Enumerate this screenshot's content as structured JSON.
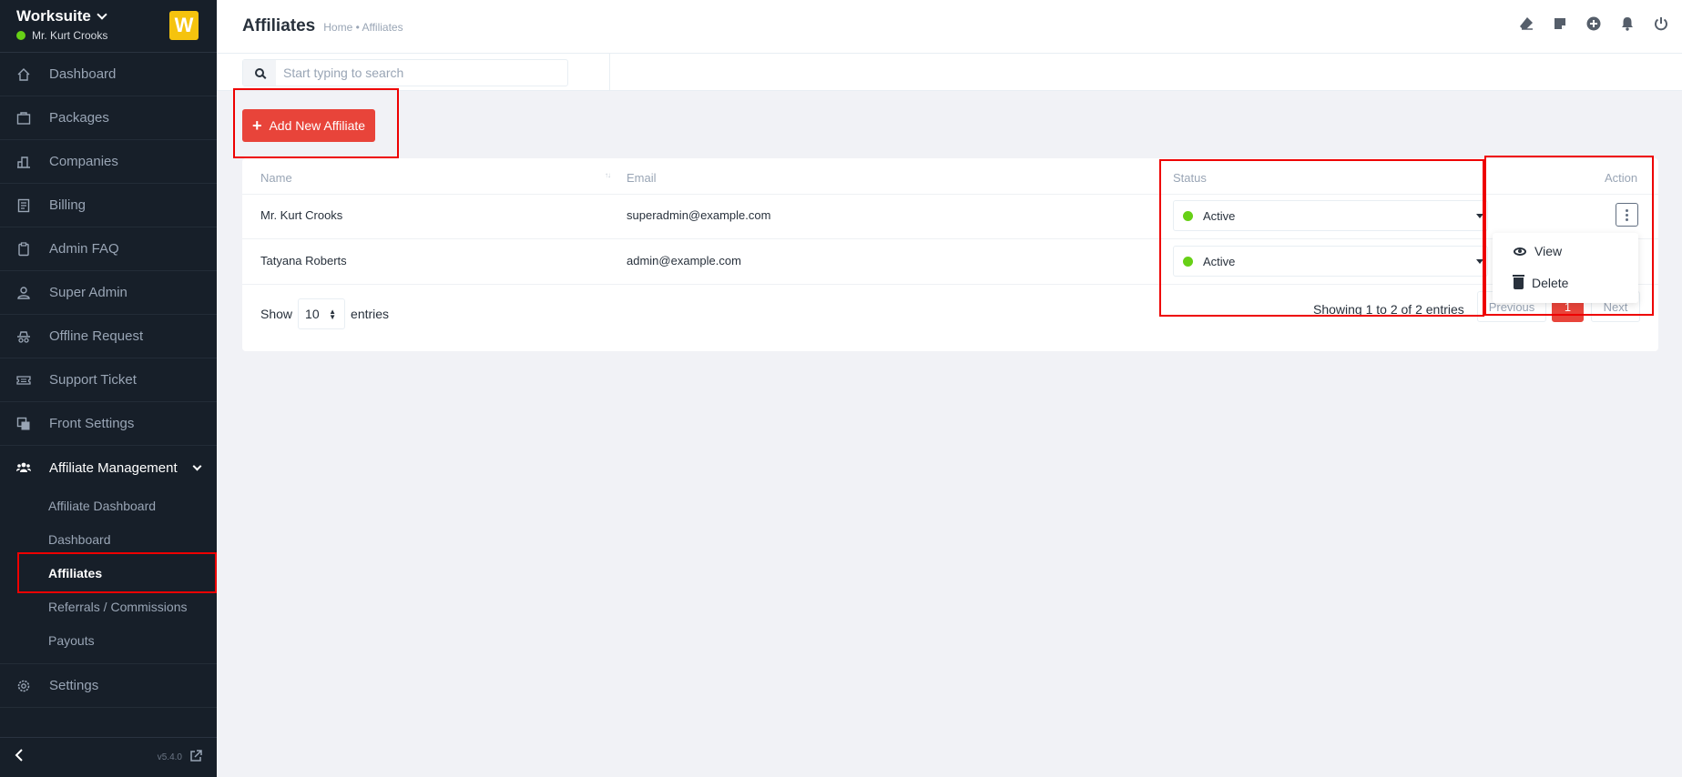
{
  "brand": {
    "name": "Worksuite",
    "user": "Mr. Kurt Crooks",
    "logo_letter": "W"
  },
  "sidebar": {
    "items": [
      {
        "label": "Dashboard",
        "icon": "home-icon"
      },
      {
        "label": "Packages",
        "icon": "package-icon"
      },
      {
        "label": "Companies",
        "icon": "building-icon"
      },
      {
        "label": "Billing",
        "icon": "receipt-icon"
      },
      {
        "label": "Admin FAQ",
        "icon": "clipboard-icon"
      },
      {
        "label": "Super Admin",
        "icon": "user-icon"
      },
      {
        "label": "Offline Request",
        "icon": "incognito-icon"
      },
      {
        "label": "Support Ticket",
        "icon": "ticket-icon"
      },
      {
        "label": "Front Settings",
        "icon": "layers-icon"
      }
    ],
    "group": {
      "label": "Affiliate Management",
      "icon": "users-icon",
      "sub_items": [
        "Affiliate Dashboard",
        "Dashboard",
        "Affiliates",
        "Referrals / Commissions",
        "Payouts"
      ],
      "active": "Affiliates"
    },
    "settings_label": "Settings",
    "version": "v5.4.0"
  },
  "header": {
    "title": "Affiliates",
    "breadcrumb": "Home • Affiliates",
    "icons": [
      "eraser-icon",
      "sticky-note-icon",
      "plus-circle-icon",
      "bell-icon",
      "power-icon"
    ]
  },
  "search": {
    "placeholder": "Start typing to search"
  },
  "toolbar": {
    "add_label": "Add New Affiliate"
  },
  "table": {
    "columns": {
      "name": "Name",
      "email": "Email",
      "status": "Status",
      "action": "Action"
    },
    "rows": [
      {
        "name": "Mr. Kurt Crooks",
        "email": "superadmin@example.com",
        "status": "Active"
      },
      {
        "name": "Tatyana Roberts",
        "email": "admin@example.com",
        "status": "Active"
      }
    ],
    "show_label": "Show",
    "entries_label": "entries",
    "page_length": "10",
    "showing": "Showing 1 to 2 of 2 entries",
    "pagination": {
      "previous": "Previous",
      "current": "1",
      "next": "Next"
    }
  },
  "action_menu": {
    "view": "View",
    "delete": "Delete"
  },
  "colors": {
    "accent": "#e8443a",
    "sidebar": "#171f29",
    "active_dot": "#67d016",
    "logo": "#f5c30e"
  }
}
